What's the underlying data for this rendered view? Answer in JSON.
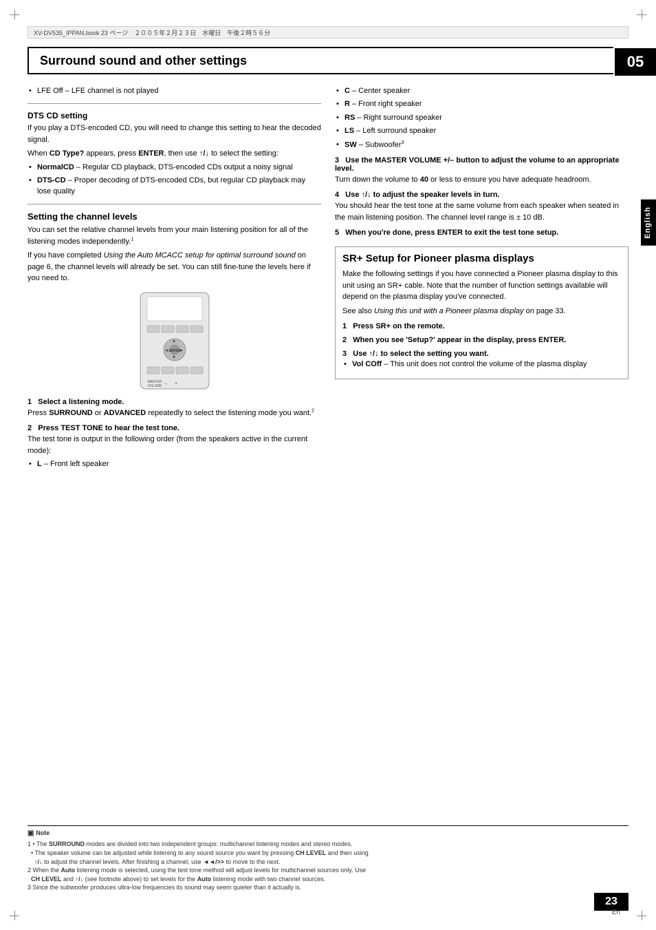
{
  "page": {
    "chapter": "05",
    "page_number": "23",
    "page_en": "En",
    "header_text": "XV-DV535_IPPAN.book  23 ページ　２００５年２月２３日　水曜日　午後２時５６分",
    "english_tab": "English"
  },
  "section_title": "Surround sound and other settings",
  "left_column": {
    "lfe_off": "LFE Off – LFE channel is not played",
    "dts_heading": "DTS CD setting",
    "dts_intro": "If you play a DTS-encoded CD, you will need to change this setting to hear the decoded signal.",
    "dts_cdtype": "When CD Type? appears, press ENTER, then use ↑/↓ to select the setting:",
    "dts_bullets": [
      "NormalCD – Regular CD playback, DTS-encoded CDs output a noisy signal",
      "DTS-CD – Proper decoding of DTS-encoded CDs, but regular CD playback may lose quality"
    ],
    "channel_levels_title": "Setting the channel levels",
    "channel_intro1": "You can set the relative channel levels from your main listening position for all of the listening modes independently.",
    "channel_intro1_sup": "1",
    "channel_intro2": "If you have completed Using the Auto MCACC setup for optimal surround sound on page 6, the channel levels will already be set. You can still fine-tune the levels here if you need to.",
    "step1_label": "1   Select a listening mode.",
    "step1_text": "Press SURROUND or ADVANCED repeatedly to select the listening mode you want.",
    "step1_sup": "2",
    "step2_label": "2   Press TEST TONE to hear the test tone.",
    "step2_text": "The test tone is output in the following order (from the speakers active in the current mode):",
    "step2_bullet": "L – Front left speaker"
  },
  "right_column": {
    "bullets": [
      "C – Center speaker",
      "R – Front right speaker",
      "RS – Right surround speaker",
      "LS – Left surround speaker",
      "SW – Subwoofer"
    ],
    "sw_sup": "3",
    "step3_label": "3   Use the MASTER VOLUME +/– button to adjust the volume to an appropriate level.",
    "step3_text": "Turn down the volume to 40 or less to ensure you have adequate headroom.",
    "step4_label": "4   Use ↑/↓ to adjust the speaker levels in turn.",
    "step4_text": "You should hear the test tone at the same volume from each speaker when seated in the main listening position. The channel level range is ± 10 dB.",
    "step5_label": "5   When you're done, press ENTER to exit the test tone setup.",
    "sr_section": {
      "title": "SR+ Setup for Pioneer plasma displays",
      "intro1": "Make the following settings if you have connected a Pioneer plasma display to this unit using an SR+ cable. Note that the number of function settings available will depend on the plasma display you've connected.",
      "intro2": "See also Using this unit with a Pioneer plasma display on page 33.",
      "step1_label": "1   Press SR+ on the remote.",
      "step2_label": "2   When you see 'Setup?' appear in the display, press ENTER.",
      "step3_label": "3   Use ↑/↓ to select the setting you want.",
      "step3_bullet": "Vol COff – This unit does not control the volume of the plasma display"
    }
  },
  "notes": {
    "note_icon": "note-icon",
    "note_title": "Note",
    "lines": [
      "1 • The SURROUND modes are divided into two independent groups: multichannel listening modes and stereo modes.",
      "  • The speaker volume can be adjusted while listening to any sound source you want by pressing CH LEVEL and then using",
      "    ↑/↓ to adjust the channel levels. After finishing a channel, use ◄◄/►► to move to the next.",
      "2 When the Auto listening mode is selected, using the test tone method will adjust levels for multichannel sources only. Use",
      "  CH LEVEL and ↑/↓ (see footnote above) to set levels for the Auto listening mode with two channel sources.",
      "3 Since the subwoofer produces ultra-low frequencies its sound may seem quieter than it actually is."
    ]
  }
}
